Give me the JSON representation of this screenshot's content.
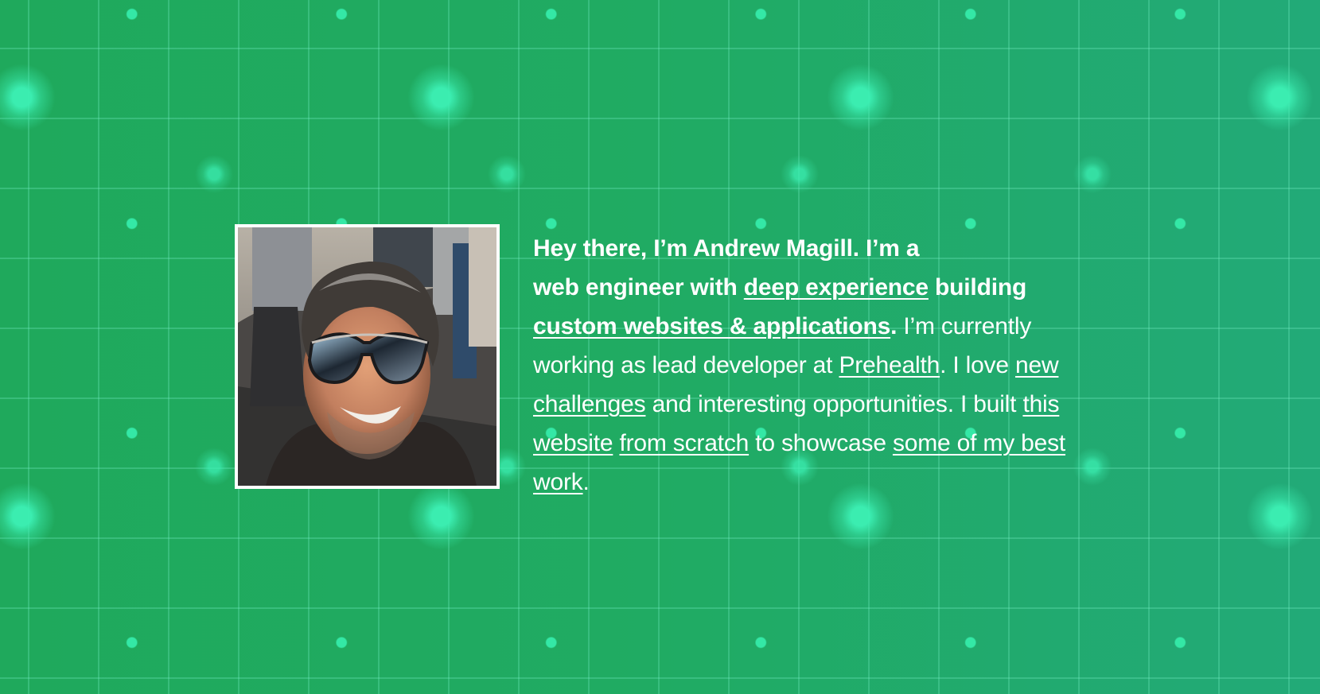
{
  "profile": {
    "photo": {
      "alt": "Andrew Magill wearing aviator sunglasses at an outdoor gathering"
    },
    "intro": {
      "greeting": "Hey there, I’m Andrew Magill. I’m a",
      "role_prefix": "web engineer with",
      "experience_link": "deep experience",
      "building_word": "building",
      "specialty_link": "custom websites & applications",
      "period": ".",
      "current_prefix": "I’m currently working as lead developer at",
      "employer_link": "Prehealth",
      "love_text": ". I love",
      "challenges_link": "new challenges",
      "opportunities_text": "and interesting opportunities. I built",
      "website_link": "this website",
      "scratch_link": "from scratch",
      "showcase_text": "to showcase",
      "work_link": "some of my best work",
      "end_period": "."
    }
  },
  "colors": {
    "background": "#21ab68",
    "grid_line": "#63d8a8",
    "dot": "#34e8a6",
    "text": "#ffffff"
  }
}
